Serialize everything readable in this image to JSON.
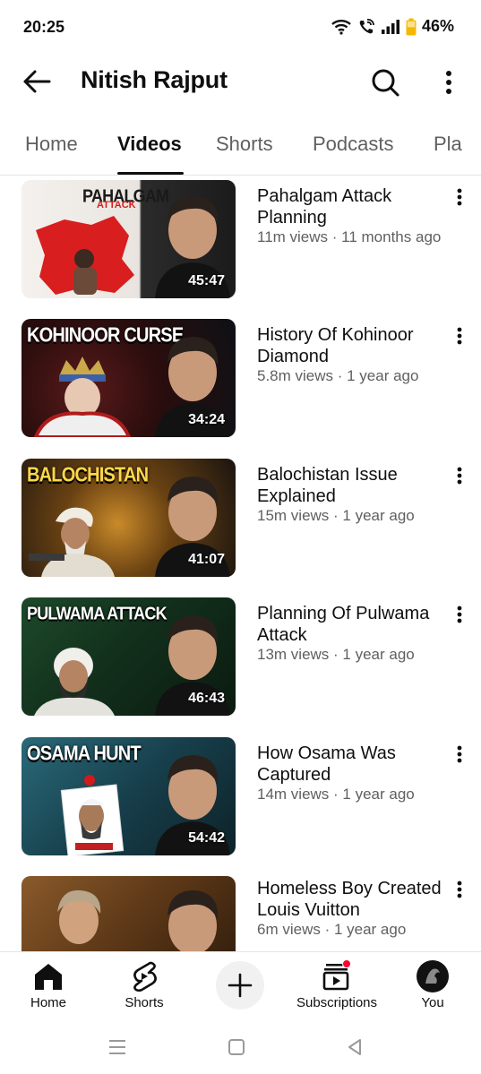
{
  "status_bar": {
    "time": "20:25",
    "battery": "46%",
    "icons": [
      "wifi-icon",
      "wifi-call-icon",
      "signal-icon",
      "battery-icon"
    ]
  },
  "header": {
    "back_icon": "arrow-left-icon",
    "title": "Nitish Rajput",
    "search_icon": "search-icon",
    "more_icon": "more-vertical-icon"
  },
  "tabs": [
    {
      "label": "Home",
      "active": false
    },
    {
      "label": "Videos",
      "active": true
    },
    {
      "label": "Shorts",
      "active": false
    },
    {
      "label": "Podcasts",
      "active": false
    },
    {
      "label": "Pla",
      "active": false
    }
  ],
  "videos": [
    {
      "title": "Pahalgam Attack Planning",
      "meta": "11m views · 11 months ago",
      "duration": "45:47",
      "thumb_text": "PAHALGAM",
      "thumb_sub": "ATTACK",
      "accent": "#d81e1e"
    },
    {
      "title": "History Of Kohinoor Diamond",
      "meta": "5.8m views · 1 year ago",
      "duration": "34:24",
      "thumb_text": "KOHINOOR CURSE",
      "thumb_sub": "",
      "accent": "#1f3b6e"
    },
    {
      "title": "Balochistan Issue Explained",
      "meta": "15m views · 1 year ago",
      "duration": "41:07",
      "thumb_text": "BALOCHISTAN",
      "thumb_sub": "",
      "accent": "#c8a24a"
    },
    {
      "title": "Planning Of Pulwama Attack",
      "meta": "13m views · 1 year ago",
      "duration": "46:43",
      "thumb_text": "PULWAMA ATTACK",
      "thumb_sub": "",
      "accent": "#1f6b3a"
    },
    {
      "title": "How Osama Was Captured",
      "meta": "14m views · 1 year ago",
      "duration": "54:42",
      "thumb_text": "OSAMA HUNT",
      "thumb_sub": "",
      "accent": "#1d5a6a"
    },
    {
      "title": "Homeless Boy Created Louis Vuitton",
      "meta": "6m views · 1 year ago",
      "duration": "",
      "thumb_text": "",
      "thumb_sub": "",
      "accent": "#7a4a22"
    }
  ],
  "bottom_nav": {
    "home": "Home",
    "shorts": "Shorts",
    "create_icon": "plus-icon",
    "subscriptions": "Subscriptions",
    "you": "You"
  },
  "system_nav": [
    "menu-icon",
    "home-square-icon",
    "back-triangle-icon"
  ]
}
